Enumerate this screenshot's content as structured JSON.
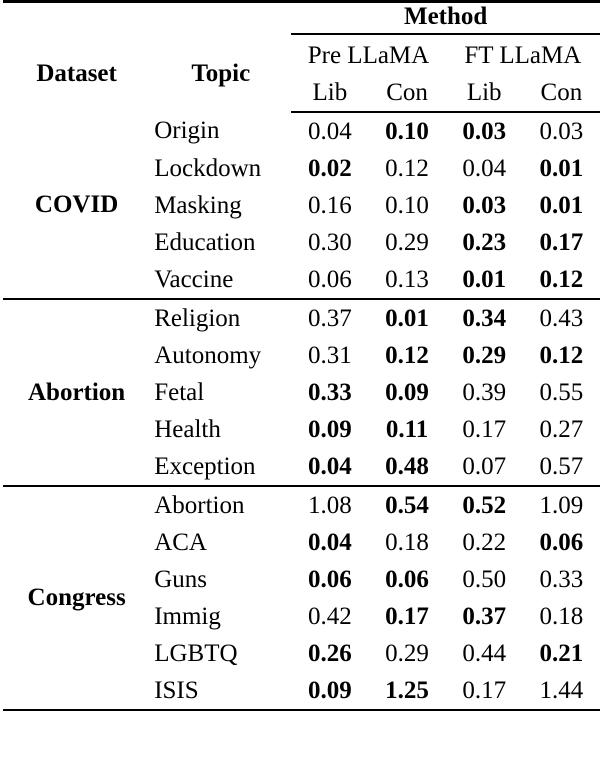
{
  "table": {
    "columns": {
      "dataset_header": "Dataset",
      "topic_header": "Topic",
      "method_header": "Method",
      "groups": [
        {
          "label": "Pre LLaMA",
          "subs": [
            "Lib",
            "Con"
          ]
        },
        {
          "label": "FT LLaMA",
          "subs": [
            "Lib",
            "Con"
          ]
        }
      ]
    },
    "sections": [
      {
        "dataset": "COVID",
        "rows": [
          {
            "topic": "Origin",
            "values": [
              "0.04",
              "0.10",
              "0.03",
              "0.03"
            ],
            "bold": [
              false,
              true,
              true,
              false
            ]
          },
          {
            "topic": "Lockdown",
            "values": [
              "0.02",
              "0.12",
              "0.04",
              "0.01"
            ],
            "bold": [
              true,
              false,
              false,
              true
            ]
          },
          {
            "topic": "Masking",
            "values": [
              "0.16",
              "0.10",
              "0.03",
              "0.01"
            ],
            "bold": [
              false,
              false,
              true,
              true
            ]
          },
          {
            "topic": "Education",
            "values": [
              "0.30",
              "0.29",
              "0.23",
              "0.17"
            ],
            "bold": [
              false,
              false,
              true,
              true
            ]
          },
          {
            "topic": "Vaccine",
            "values": [
              "0.06",
              "0.13",
              "0.01",
              "0.12"
            ],
            "bold": [
              false,
              false,
              true,
              true
            ]
          }
        ]
      },
      {
        "dataset": "Abortion",
        "rows": [
          {
            "topic": "Religion",
            "values": [
              "0.37",
              "0.01",
              "0.34",
              "0.43"
            ],
            "bold": [
              false,
              true,
              true,
              false
            ]
          },
          {
            "topic": "Autonomy",
            "values": [
              "0.31",
              "0.12",
              "0.29",
              "0.12"
            ],
            "bold": [
              false,
              true,
              true,
              true
            ]
          },
          {
            "topic": "Fetal",
            "values": [
              "0.33",
              "0.09",
              "0.39",
              "0.55"
            ],
            "bold": [
              true,
              true,
              false,
              false
            ]
          },
          {
            "topic": "Health",
            "values": [
              "0.09",
              "0.11",
              "0.17",
              "0.27"
            ],
            "bold": [
              true,
              true,
              false,
              false
            ]
          },
          {
            "topic": "Exception",
            "values": [
              "0.04",
              "0.48",
              "0.07",
              "0.57"
            ],
            "bold": [
              true,
              true,
              false,
              false
            ]
          }
        ]
      },
      {
        "dataset": "Congress",
        "rows": [
          {
            "topic": "Abortion",
            "values": [
              "1.08",
              "0.54",
              "0.52",
              "1.09"
            ],
            "bold": [
              false,
              true,
              true,
              false
            ]
          },
          {
            "topic": "ACA",
            "values": [
              "0.04",
              "0.18",
              "0.22",
              "0.06"
            ],
            "bold": [
              true,
              false,
              false,
              true
            ]
          },
          {
            "topic": "Guns",
            "values": [
              "0.06",
              "0.06",
              "0.50",
              "0.33"
            ],
            "bold": [
              true,
              true,
              false,
              false
            ]
          },
          {
            "topic": "Immig",
            "values": [
              "0.42",
              "0.17",
              "0.37",
              "0.18"
            ],
            "bold": [
              false,
              true,
              true,
              false
            ]
          },
          {
            "topic": "LGBTQ",
            "values": [
              "0.26",
              "0.29",
              "0.44",
              "0.21"
            ],
            "bold": [
              true,
              false,
              false,
              true
            ]
          },
          {
            "topic": "ISIS",
            "values": [
              "0.09",
              "1.25",
              "0.17",
              "1.44"
            ],
            "bold": [
              true,
              true,
              false,
              false
            ]
          }
        ]
      }
    ]
  }
}
